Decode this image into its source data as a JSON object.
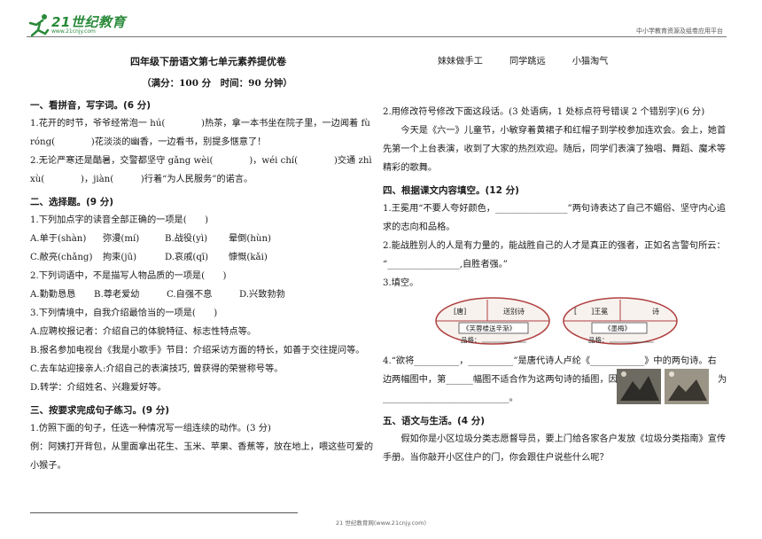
{
  "header": {
    "logo_text": "21世纪教育",
    "logo_sub": "www.21cnjy.com",
    "platform": "中小学教育资源及组卷应用平台"
  },
  "paper": {
    "title": "四年级下册语文第七单元素养提优卷",
    "subtitle": "（满分：100 分　时间：90 分钟）"
  },
  "left": {
    "s1": {
      "heading": "一、看拼音，写字词。(6 分)",
      "q1a": "1.花开的时节，爷爷经常泡一 hú(　　　　)热茶，拿一本书坐在院子里，一边闻着 fù",
      "q1b": "róng(　　　　)花淡淡的幽香，一边看书，别提多惬意了！",
      "q2a": "2.无论严寒还是酷暑，交警都坚守 gǎng wèi(　　　　)，wéi chí(　　　　)交通 zhì",
      "q2b": "xù(　　　　)，jiàn(　　　)行着“为人民服务”的诺言。"
    },
    "s2": {
      "heading": "二、选择题。(9 分)",
      "q1": "1.下列加点字的读音全部正确的一项是(　　)",
      "q1_opts_a": [
        "A.单于(shàn)",
        "弥漫(mí)",
        "B.战役(yì)",
        "晕倒(hùn)"
      ],
      "q1_opts_b": [
        "C.敝亮(chǎng)",
        "拘束(jū)",
        "D.哀戚(qī)",
        "慷慨(kǎi)"
      ],
      "q2": "2.下列词语中，不是描写人物品质的一项是(　　)",
      "q2_opts": [
        "A.勤勤恳恳",
        "B.尊老爱幼",
        "C.自强不息",
        "D.兴致勃勃"
      ],
      "q3": "3.下列情境中，自我介绍最恰当的一项是(　　)",
      "q3_a": "A.应聘校报记者：介绍自己的体貌特征、标志性特点等。",
      "q3_b": "B.报名参加电视台《我是小歌手》节目：介绍采访方面的特长，如善于交往提问等。",
      "q3_c": "C.去车站迎接亲人:介绍自己的表演技巧, 曾获得的荣誉称号等。",
      "q3_d": "D.转学：介绍姓名、兴趣爱好等。"
    },
    "s3": {
      "heading": "三、按要求完成句子练习。(9 分)",
      "q1": "1.仿照下面的句子，任选一种情况写一组连续的动作。(3 分)",
      "example_a": "例：阿姨打开背包，从里面拿出花生、玉米、苹果、香蕉等，放在地上，喂这些可爱的",
      "example_b": "小猴子。"
    }
  },
  "right": {
    "options": [
      "妹妹做手工",
      "同学跳远",
      "小猫淘气"
    ],
    "q2": "2.用修改符号修改下面这段话。(3 处语病，1 处标点符号错误 2 个错别字)(6 分)",
    "para_a": "今天是《六一》儿童节，小敏穿着黄裙子和红帽子到学校参加连欢会。会上，她首",
    "para_b": "先第一个上台表演，收到了大家的热烈欢迎。随后，同学们表演了独唱、舞蹈、魔术等",
    "para_c": "精彩的歌舞。",
    "s4": {
      "heading": "四、根据课文内容填空。(12 分)",
      "q1a": "1.王冕用“不要人夸好颜色，________________”两句诗表达了自己不媚俗、坚守内心追",
      "q1b": "求的志向和品格。",
      "q2a": "2.能战胜别人的人是有力量的，能战胜自己的人才是真正的强者，正如名言警句所云：",
      "q2b": "“________________,自胜者强。”",
      "q3": "3.填空。",
      "oval1": {
        "top_left": "[唐]",
        "top_right": "送别诗",
        "book": "《芙蓉楼送辛渐》",
        "trait": "品格："
      },
      "oval2": {
        "top_left": "[　　]王冕",
        "top_right": "诗",
        "book": "《墨梅》",
        "trait": "品格："
      },
      "q4a": "4.“欲将__________，__________”是唐代诗人卢纶《____________》中的两句诗。右",
      "q4b": "边两幅图中，第______幅图不适合作为这两句诗的插图，因",
      "q4b_end": "为",
      "q4c": "____________________________。"
    },
    "s5": {
      "heading": "五、语文与生活。(4 分)",
      "para_a": "假如你是小区垃圾分类志愿督导员，要上门给各家各户发放《垃圾分类指南》宣传",
      "para_b": "手册。当你敲开小区住户的门，你会跟住户说些什么呢？"
    }
  },
  "footer": "21 世纪教育网(www.21cnjy.com)"
}
